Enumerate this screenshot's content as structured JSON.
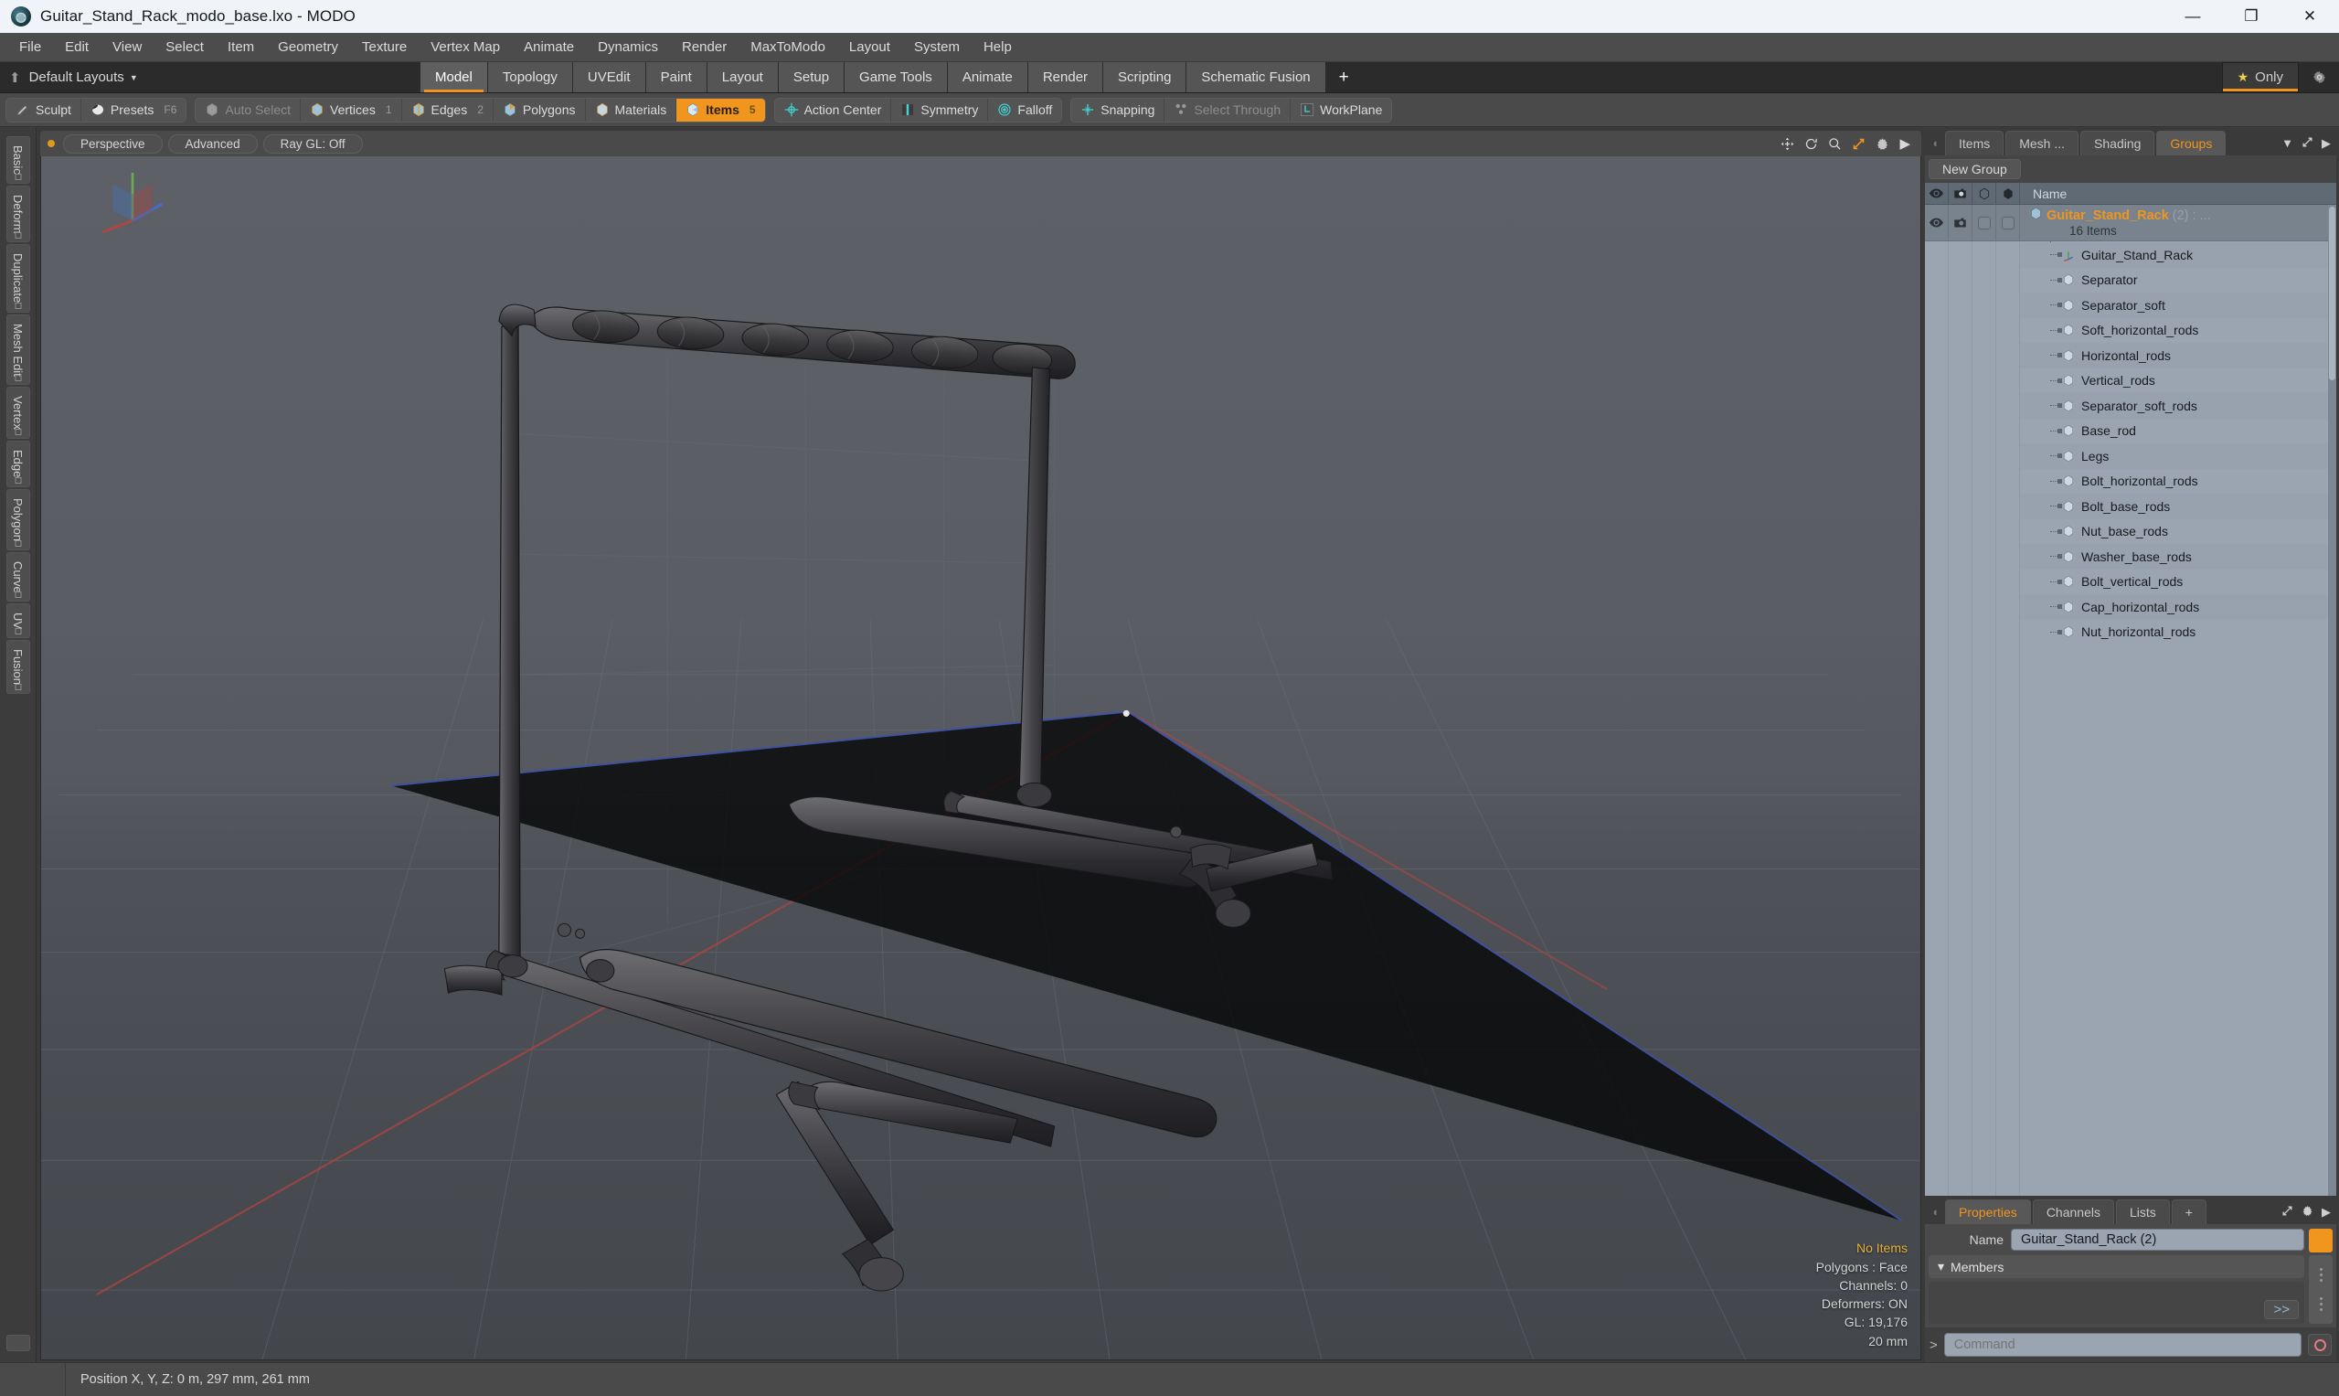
{
  "window": {
    "title": "Guitar_Stand_Rack_modo_base.lxo - MODO",
    "minimize": "—",
    "maximize": "❐",
    "close": "✕"
  },
  "menubar": {
    "items": [
      "File",
      "Edit",
      "View",
      "Select",
      "Item",
      "Geometry",
      "Texture",
      "Vertex Map",
      "Animate",
      "Dynamics",
      "Render",
      "MaxToModo",
      "Layout",
      "System",
      "Help"
    ]
  },
  "layoutbar": {
    "layouts_label": "Default Layouts",
    "tabs": [
      "Model",
      "Topology",
      "UVEdit",
      "Paint",
      "Layout",
      "Setup",
      "Game Tools",
      "Animate",
      "Render",
      "Scripting",
      "Schematic Fusion"
    ],
    "active_tab": "Model",
    "add_tab": "+",
    "only_label": "Only",
    "accent_color": "#f0951e"
  },
  "toolbar": {
    "group1": [
      {
        "label": "Sculpt",
        "icon": "sculpt-icon",
        "num": "",
        "state": "normal"
      },
      {
        "label": "Presets",
        "icon": "presets-icon",
        "num": "F6",
        "state": "normal"
      }
    ],
    "group2": [
      {
        "label": "Auto Select",
        "icon": "auto-select-icon",
        "num": "",
        "state": "dim"
      },
      {
        "label": "Vertices",
        "icon": "vertices-icon",
        "num": "1",
        "state": "normal"
      },
      {
        "label": "Edges",
        "icon": "edges-icon",
        "num": "2",
        "state": "normal"
      },
      {
        "label": "Polygons",
        "icon": "polygons-icon",
        "num": "",
        "state": "normal"
      },
      {
        "label": "Materials",
        "icon": "materials-icon",
        "num": "",
        "state": "normal"
      },
      {
        "label": "Items",
        "icon": "items-icon",
        "num": "5",
        "state": "active"
      }
    ],
    "group3": [
      {
        "label": "Action Center",
        "icon": "action-center-icon",
        "num": "",
        "state": "normal"
      },
      {
        "label": "Symmetry",
        "icon": "symmetry-icon",
        "num": "",
        "state": "normal"
      },
      {
        "label": "Falloff",
        "icon": "falloff-icon",
        "num": "",
        "state": "normal"
      }
    ],
    "group4": [
      {
        "label": "Snapping",
        "icon": "snapping-icon",
        "num": "",
        "state": "normal"
      },
      {
        "label": "Select Through",
        "icon": "select-through-icon",
        "num": "",
        "state": "dim"
      },
      {
        "label": "WorkPlane",
        "icon": "workplane-icon",
        "num": "",
        "state": "normal"
      }
    ]
  },
  "left_tabs": [
    "Basic",
    "Deform",
    "Duplicate",
    "Mesh Edit",
    "Vertex",
    "Edge",
    "Polygon",
    "Curve",
    "UV",
    "Fusion"
  ],
  "viewport": {
    "header_buttons": [
      "Perspective",
      "Advanced",
      "Ray GL: Off"
    ],
    "info": {
      "selection": "No Items",
      "polygons": "Polygons : Face",
      "channels": "Channels: 0",
      "deformers": "Deformers: ON",
      "gl": "GL: 19,176",
      "grid": "20 mm"
    }
  },
  "right_panel": {
    "tabs": [
      "Items",
      "Mesh ...",
      "Shading",
      "Groups"
    ],
    "active_tab": "Groups",
    "new_group_label": "New Group",
    "tree": {
      "columns": [
        "eye-icon",
        "render-icon",
        "wire-cube-icon",
        "solid-cube-icon"
      ],
      "name_header": "Name",
      "selected_group": {
        "name": "Guitar_Stand_Rack",
        "count": "(2)",
        "suffix": ": ...",
        "sub": "16 Items"
      },
      "items": [
        {
          "label": "Guitar_Stand_Rack",
          "icon": "locator-icon"
        },
        {
          "label": "Separator",
          "icon": "mesh-icon"
        },
        {
          "label": "Separator_soft",
          "icon": "mesh-icon"
        },
        {
          "label": "Soft_horizontal_rods",
          "icon": "mesh-icon"
        },
        {
          "label": "Horizontal_rods",
          "icon": "mesh-icon"
        },
        {
          "label": "Vertical_rods",
          "icon": "mesh-icon"
        },
        {
          "label": "Separator_soft_rods",
          "icon": "mesh-icon"
        },
        {
          "label": "Base_rod",
          "icon": "mesh-icon"
        },
        {
          "label": "Legs",
          "icon": "mesh-icon"
        },
        {
          "label": "Bolt_horizontal_rods",
          "icon": "mesh-icon"
        },
        {
          "label": "Bolt_base_rods",
          "icon": "mesh-icon"
        },
        {
          "label": "Nut_base_rods",
          "icon": "mesh-icon"
        },
        {
          "label": "Washer_base_rods",
          "icon": "mesh-icon"
        },
        {
          "label": "Bolt_vertical_rods",
          "icon": "mesh-icon"
        },
        {
          "label": "Cap_horizontal_rods",
          "icon": "mesh-icon"
        },
        {
          "label": "Nut_horizontal_rods",
          "icon": "mesh-icon"
        }
      ]
    }
  },
  "properties": {
    "tabs": [
      "Properties",
      "Channels",
      "Lists"
    ],
    "active_tab": "Properties",
    "add_tab": "+",
    "name_label": "Name",
    "name_value": "Guitar_Stand_Rack (2)",
    "members_label": "Members",
    "members_more": ">>"
  },
  "command": {
    "prompt": ">",
    "placeholder": "Command",
    "value": ""
  },
  "statusbar": {
    "position": "Position X, Y, Z:   0 m, 297 mm, 261 mm"
  }
}
